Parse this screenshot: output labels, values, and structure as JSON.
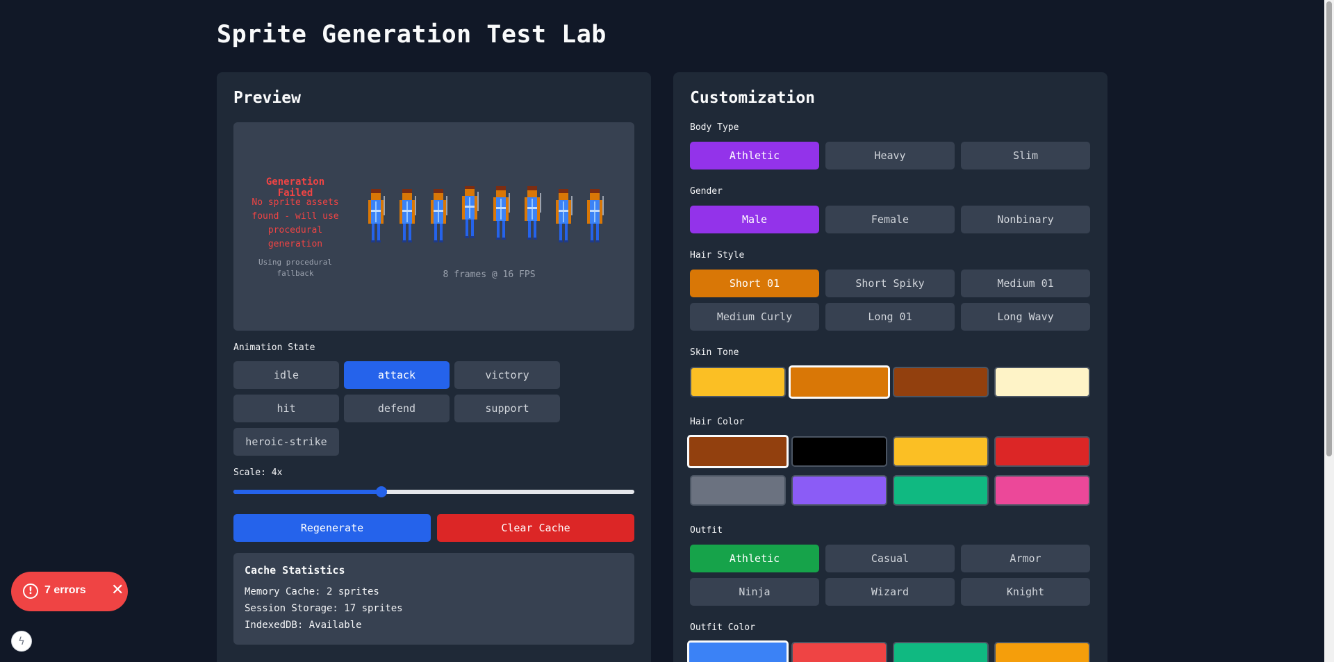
{
  "page": {
    "title": "Sprite Generation Test Lab"
  },
  "preview": {
    "heading": "Preview",
    "error_title": "Generation Failed",
    "error_message": "No sprite assets found - will use procedural generation",
    "fallback_note": "Using procedural fallback",
    "frames_caption": "8 frames @ 16 FPS",
    "frame_count": 8
  },
  "animation": {
    "label": "Animation State",
    "states": [
      "idle",
      "attack",
      "victory",
      "hit",
      "defend",
      "support",
      "heroic-strike"
    ],
    "selected": "attack"
  },
  "scale": {
    "label": "Scale: 4x",
    "value": 4,
    "min": 1,
    "max": 8
  },
  "actions": {
    "regenerate": "Regenerate",
    "clear_cache": "Clear Cache"
  },
  "cache": {
    "title": "Cache Statistics",
    "memory": "Memory Cache: 2 sprites",
    "session": "Session Storage: 17 sprites",
    "indexeddb": "IndexedDB: Available"
  },
  "customization": {
    "heading": "Customization",
    "body_type": {
      "label": "Body Type",
      "options": [
        "Athletic",
        "Heavy",
        "Slim"
      ],
      "selected": "Athletic"
    },
    "gender": {
      "label": "Gender",
      "options": [
        "Male",
        "Female",
        "Nonbinary"
      ],
      "selected": "Male"
    },
    "hair_style": {
      "label": "Hair Style",
      "options": [
        "Short 01",
        "Short Spiky",
        "Medium 01",
        "Medium Curly",
        "Long 01",
        "Long Wavy"
      ],
      "selected": "Short 01"
    },
    "skin_tone": {
      "label": "Skin Tone",
      "colors": [
        "#fbbf24",
        "#d97706",
        "#92400e",
        "#fef3c7"
      ],
      "selected_index": 1
    },
    "hair_color": {
      "label": "Hair Color",
      "colors": [
        "#92400e",
        "#000000",
        "#fbbf24",
        "#dc2626",
        "#6b7280",
        "#8b5cf6",
        "#10b981",
        "#ec4899"
      ],
      "selected_index": 0
    },
    "outfit": {
      "label": "Outfit",
      "options": [
        "Athletic",
        "Casual",
        "Armor",
        "Ninja",
        "Wizard",
        "Knight"
      ],
      "selected": "Athletic"
    },
    "outfit_color": {
      "label": "Outfit Color",
      "colors": [
        "#3b82f6",
        "#ef4444",
        "#10b981",
        "#f59e0b"
      ],
      "selected_index": 0
    }
  },
  "toast": {
    "label": "7 errors"
  }
}
